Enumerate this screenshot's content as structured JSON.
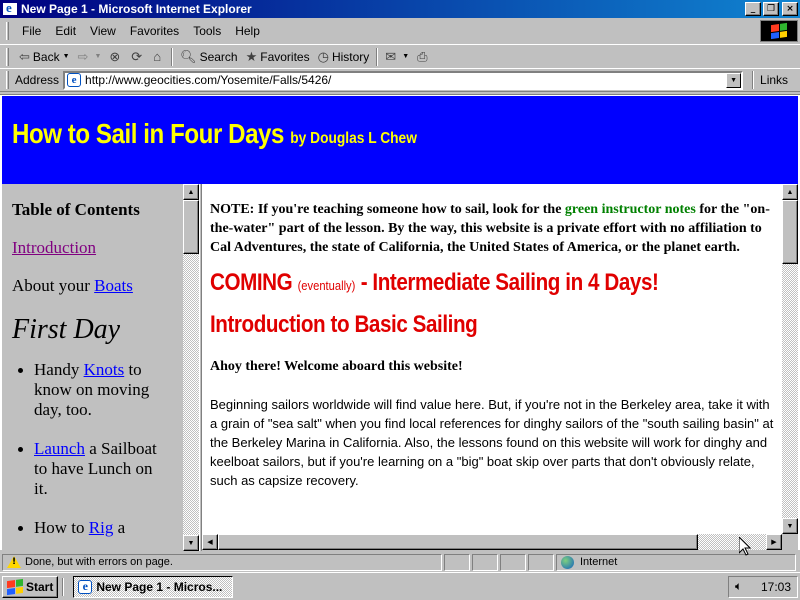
{
  "window": {
    "title": "New Page 1 - Microsoft Internet Explorer",
    "buttons": {
      "minimize": "_",
      "maximize": "❐",
      "close": "×"
    }
  },
  "menu": {
    "items": [
      {
        "label": "File"
      },
      {
        "label": "Edit"
      },
      {
        "label": "View"
      },
      {
        "label": "Favorites"
      },
      {
        "label": "Tools"
      },
      {
        "label": "Help"
      }
    ]
  },
  "toolbar": {
    "back": "Back",
    "search": "Search",
    "favorites": "Favorites",
    "history": "History"
  },
  "address": {
    "label": "Address",
    "url": "http://www.geocities.com/Yosemite/Falls/5426/",
    "links_label": "Links"
  },
  "page": {
    "banner_title": "How to Sail in Four Days",
    "banner_byline": "by Douglas L Chew",
    "toc": {
      "heading": "Table of Contents",
      "introduction": "Introduction",
      "about_prefix": "About your",
      "about_link": "Boats",
      "day_heading": "First Day",
      "items": [
        {
          "prefix": "Handy",
          "link": "Knots",
          "suffix": "to know on moving day, too."
        },
        {
          "prefix": "",
          "link": "Launch",
          "suffix": "a Sailboat to have Lunch on it."
        },
        {
          "prefix": "How to",
          "link": "Rig",
          "suffix": "a"
        }
      ]
    },
    "main": {
      "note_before": "NOTE:  If you're teaching someone how to sail, look for the",
      "note_green": "green instructor notes",
      "note_after": "for the \"on-the-water\" part of the lesson.  By the way, this website is a private effort with no affiliation to Cal Adventures, the state of California, the United States of America, or the planet earth.",
      "coming_big": "COMING",
      "coming_small": "(eventually)",
      "coming_rest": "- Intermediate Sailing in 4 Days!",
      "intro_heading": "Introduction to Basic Sailing",
      "ahoy": "Ahoy there!  Welcome aboard this website!",
      "paragraph": "Beginning sailors worldwide will find value here.  But, if you're not in the Berkeley area, take it with a grain of \"sea salt\" when you find local references for dinghy sailors of the \"south sailing basin\" at the Berkeley Marina in California.  Also, the lessons found on this website will work for dinghy and keelboat sailors, but if you're learning on a \"big\" boat skip over parts that don't obviously relate, such as capsize recovery."
    }
  },
  "status": {
    "text": "Done, but with errors on page.",
    "zone": "Internet"
  },
  "taskbar": {
    "start": "Start",
    "task": "New Page 1 - Micros...",
    "clock": "17:03"
  },
  "colors": {
    "banner_bg": "#0000ff",
    "banner_text": "#ffff00",
    "heading_red": "#e00000",
    "instructor_green": "#008000",
    "titlebar": "#000080"
  }
}
